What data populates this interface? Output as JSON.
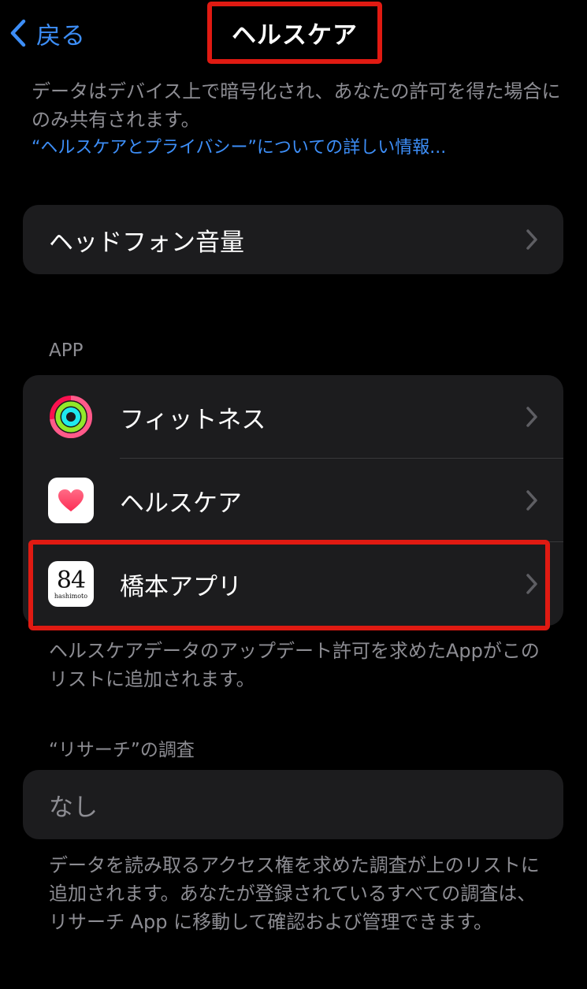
{
  "nav": {
    "back_label": "戻る",
    "title": "ヘルスケア"
  },
  "intro": {
    "text": "データはデバイス上で暗号化され、あなたの許可を得た場合にのみ共有されます。",
    "link": "“ヘルスケアとプライバシー”についての詳しい情報..."
  },
  "headphone": {
    "label": "ヘッドフォン音量"
  },
  "apps": {
    "header": "APP",
    "items": [
      {
        "label": "フィットネス",
        "icon": "fitness-rings-icon"
      },
      {
        "label": "ヘルスケア",
        "icon": "health-heart-icon"
      },
      {
        "label": "橋本アプリ",
        "icon": "hashimoto-84-icon",
        "icon_text": "84",
        "icon_subtext": "hashimoto"
      }
    ],
    "footnote": "ヘルスケアデータのアップデート許可を求めたAppがこのリストに追加されます。"
  },
  "research": {
    "header": "“リサーチ”の調査",
    "none_label": "なし",
    "footnote": "データを読み取るアクセス権を求めた調査が上のリストに追加されます。あなたが登録されているすべての調査は、リサーチ App に移動して確認および管理できます。"
  },
  "colors": {
    "accent": "#3d8ef7",
    "highlight": "#e01a12",
    "background": "#000000",
    "group_bg": "#1c1c1e",
    "secondary_text": "#8d8d93"
  }
}
